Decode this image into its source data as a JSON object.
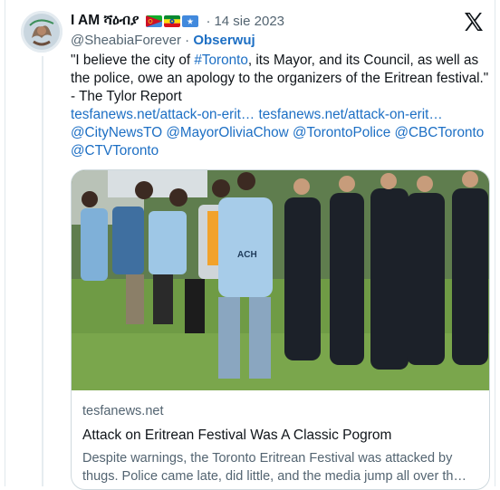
{
  "tweet": {
    "display_name": "I AM ሻዕብያ",
    "flags": [
      {
        "name": "eritrea-flag",
        "colors": [
          "#12ad2b",
          "#ce1126",
          "#4189dd"
        ]
      },
      {
        "name": "ethiopia-flag",
        "colors": [
          "#078930",
          "#fcdd09",
          "#da121a"
        ]
      },
      {
        "name": "somalia-flag",
        "colors": [
          "#4189dd",
          "#ffffff"
        ]
      }
    ],
    "separator": "·",
    "date": "14 sie 2023",
    "handle": "@SheabiaForever",
    "follow_label": "Obserwuj",
    "text_prefix": "\"I believe the city of ",
    "hashtag": "#Toronto",
    "text_suffix": ", its Mayor, and its Council, as well as the police, owe an apology to the organizers of the Eritrean festival.\" - The Tylor Report",
    "links": [
      "tesfanews.net/attack-on-erit…",
      "tesfanews.net/attack-on-erit…"
    ],
    "mentions": [
      "@CityNewsTO",
      "@MayorOliviaChow",
      "@TorontoPolice",
      "@CBCToronto",
      "@CTVToronto"
    ]
  },
  "card": {
    "domain": "tesfanews.net",
    "title": "Attack on Eritrean Festival Was A Classic Pogrom",
    "description": "Despite warnings, the Toronto Eritrean Festival was attacked by thugs. Police came late, did little, and the media jump all over th…",
    "photo_shirt_text": "ACH"
  },
  "colors": {
    "link": "#1d6fc4",
    "secondary_text": "#536471",
    "primary_text": "#0f1419",
    "border": "#cfd9de"
  }
}
